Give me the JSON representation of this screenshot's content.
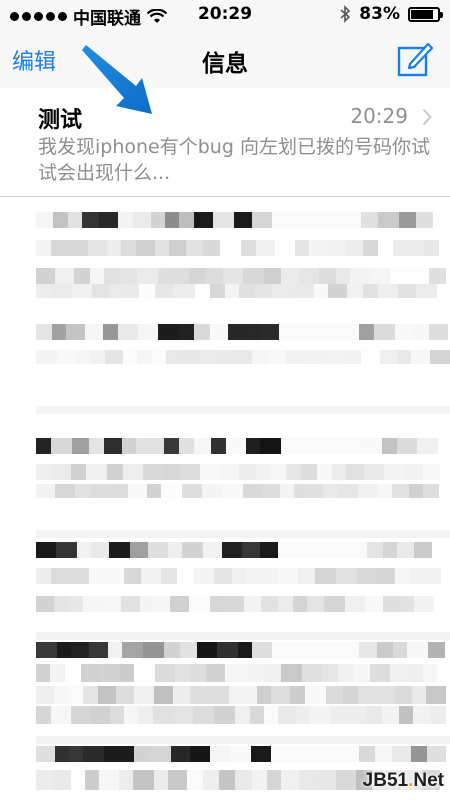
{
  "status_bar": {
    "carrier": "中国联通",
    "time": "20:29",
    "battery_percent": "83%",
    "battery_level": 0.83
  },
  "nav": {
    "edit_label": "编辑",
    "title": "信息",
    "compose_icon": "compose-icon"
  },
  "conversations": [
    {
      "name": "测试",
      "time": "20:29",
      "preview": "我发现iphone有个bug 向左划已拨的号码你试试会出现什么..."
    }
  ],
  "watermark": {
    "prefix": "JB51",
    "dot": ".",
    "suffix": "Net"
  }
}
